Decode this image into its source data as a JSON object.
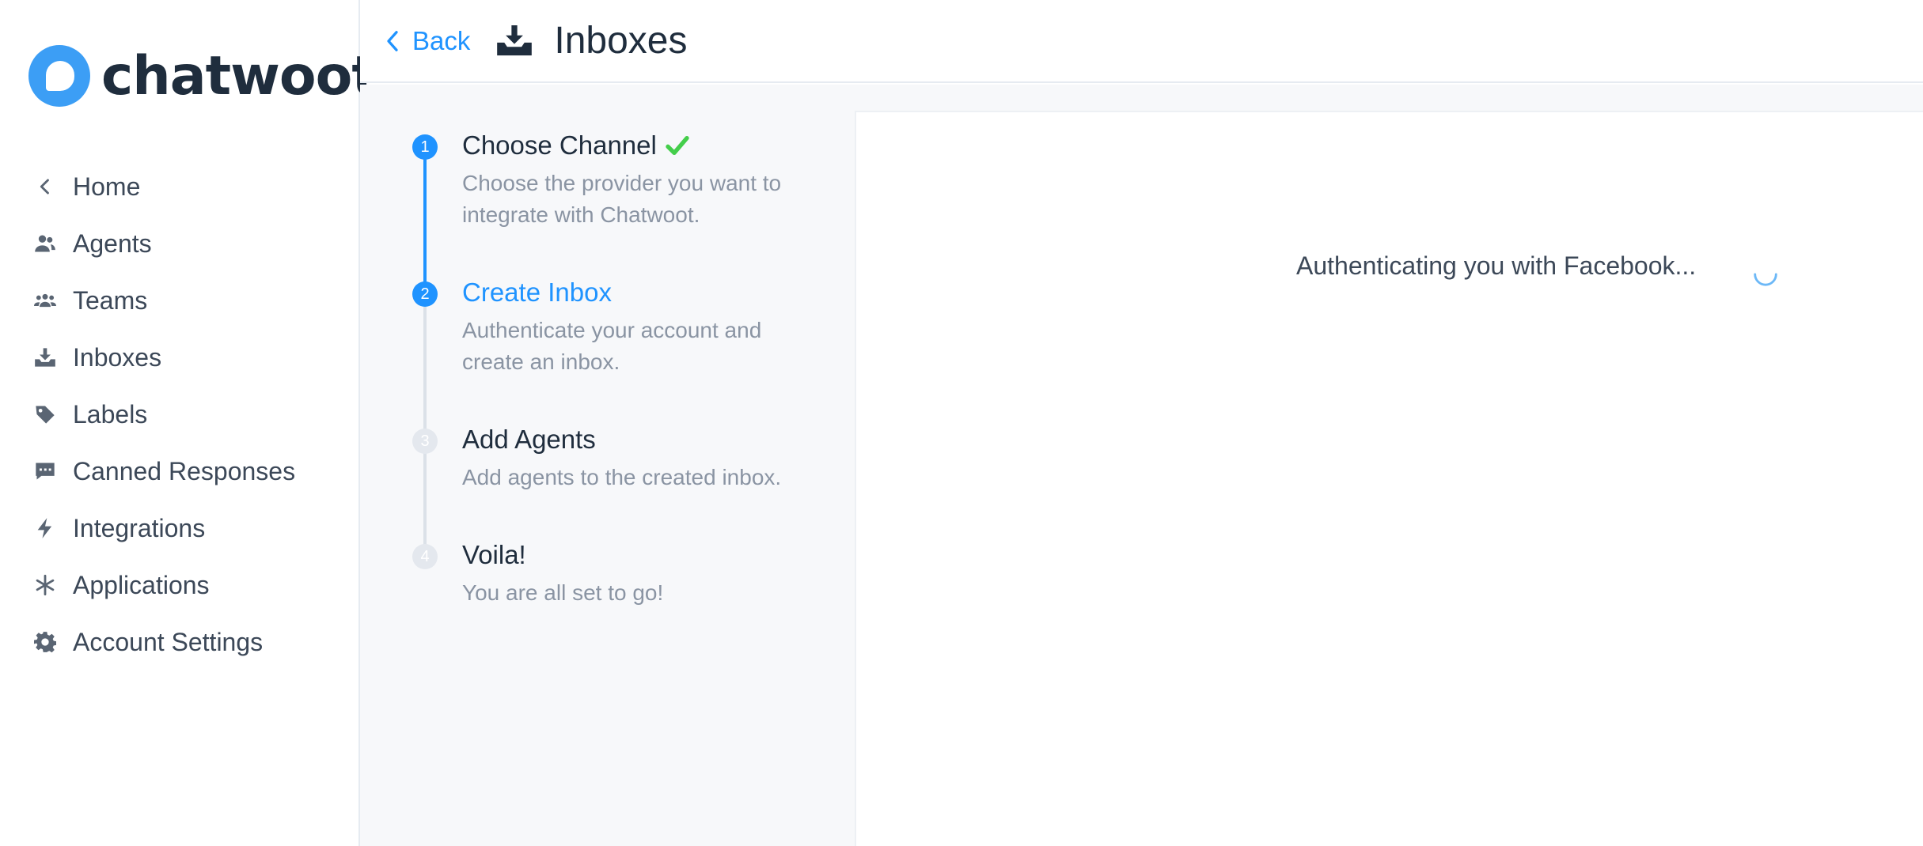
{
  "brand": {
    "name": "chatwoot",
    "accent": "#1f93ff",
    "logo_color": "#3c9ef5"
  },
  "sidebar": {
    "items": [
      {
        "label": "Home",
        "icon": "chevron-left-icon"
      },
      {
        "label": "Agents",
        "icon": "people-icon"
      },
      {
        "label": "Teams",
        "icon": "team-icon"
      },
      {
        "label": "Inboxes",
        "icon": "inbox-download-icon"
      },
      {
        "label": "Labels",
        "icon": "tag-icon"
      },
      {
        "label": "Canned Responses",
        "icon": "chat-bubble-icon"
      },
      {
        "label": "Integrations",
        "icon": "lightning-icon"
      },
      {
        "label": "Applications",
        "icon": "asterisk-icon"
      },
      {
        "label": "Account Settings",
        "icon": "gear-icon"
      }
    ]
  },
  "header": {
    "back_label": "Back",
    "title": "Inboxes",
    "icon": "inbox-download-icon"
  },
  "steps": [
    {
      "number": "1",
      "title": "Choose Channel",
      "description": "Choose the provider you want to integrate with Chatwoot.",
      "state": "completed"
    },
    {
      "number": "2",
      "title": "Create Inbox",
      "description": "Authenticate your account and create an inbox.",
      "state": "current"
    },
    {
      "number": "3",
      "title": "Add Agents",
      "description": "Add agents to the created inbox.",
      "state": "pending"
    },
    {
      "number": "4",
      "title": "Voila!",
      "description": "You are all set to go!",
      "state": "pending"
    }
  ],
  "main": {
    "status_text": "Authenticating you with Facebook..."
  }
}
